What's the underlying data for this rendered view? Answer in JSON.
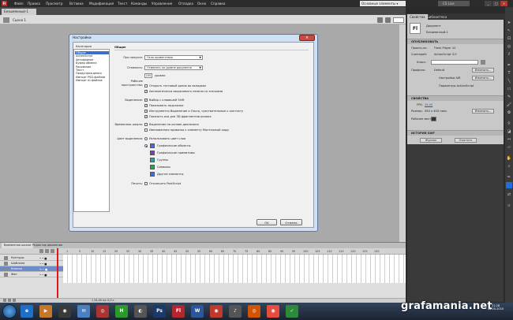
{
  "menubar": {
    "logo": "Fl",
    "items": [
      "Файл",
      "Правка",
      "Просмотр",
      "Вставка",
      "Модификация",
      "Текст",
      "Команды",
      "Управление",
      "Отладка",
      "Окно",
      "Справка"
    ],
    "workspace": "Основные элементы ▾",
    "search_icon": "search-icon",
    "cs_live": "CS Live"
  },
  "doc": {
    "tab": "Безымянный-1",
    "scene": "Сцена 1"
  },
  "dialog": {
    "title": "Настройки",
    "close": "×",
    "category_label": "Категория",
    "categories": [
      "Общие",
      "ActionScript",
      "Автоформат",
      "Буфер обмена",
      "Рисование",
      "Текст",
      "Предупреждения",
      "Импорт PSD-файлов",
      "Импорт AI-файлов"
    ],
    "section": "Общие",
    "on_launch_label": "При запуске:",
    "on_launch_value": "Окно приветствия",
    "undo_label": "Отменить:",
    "undo_value": "Отменить на уровне документа",
    "levels_value": "100",
    "levels_label": "уровни",
    "workspace_label": "Рабочее пространство:",
    "ws_opt1": "Открыть тестовый ролик во вкладках",
    "ws_opt2": "Автоматически сворачивать панели со значками",
    "selection_label": "Выделение:",
    "sel_opt1": "Выбор с клавишей Shift",
    "sel_opt2": "Показывать подсказки",
    "sel_opt3": "Инструменты Выделение и Лассо, чувствительные к контакту",
    "sel_opt4": "Показать оси для 3D-фрагментов ролика",
    "timeline_label": "Временная шкала:",
    "tl_opt1": "Выделение на основе диапазона",
    "tl_opt2": "Именованная привязка к элементу Монтажный кадр",
    "highlight_label": "Цвет выделения:",
    "hl_opt1": "Использовать цвет слоя",
    "hl_items": [
      "Графические объекты",
      "Графические примитивы",
      "Группы",
      "Символы",
      "Другие элементы"
    ],
    "hl_colors": [
      "#3f6fd1",
      "#7b3fa6",
      "#2aa3a0",
      "#2aa34c",
      "#3f6fd1"
    ],
    "printing_label": "Печать:",
    "print_opt": "Отключить PostScript",
    "ok": "OK",
    "cancel": "Отмена"
  },
  "right": {
    "tab_props": "Свойства",
    "tab_lib": "Библиотека",
    "doc_icon": "Fl",
    "doc_label": "Документ",
    "doc_name": "Безымянный-1",
    "publish_section": "ОПУБЛИКОВАТЬ",
    "player_label": "Проигр-ль:",
    "player_value": "Flash Player 10",
    "script_label": "Сценарий:",
    "script_value": "ActionScript 3.0",
    "class_label": "Класс:",
    "profile_label": "Профиль:",
    "profile_value": "Default",
    "edit_btn": "Изменить...",
    "air_label": "Настройки AIR",
    "as_label": "Параметры ActionScript",
    "props_section": "СВОЙСТВА",
    "fps_label": "FPS:",
    "fps_value": "24,00",
    "size_label": "Размер:",
    "size_value": "550 x 400 пикс.",
    "stage_label": "Рабочее место:",
    "history_section": "ИСТОРИЯ SWF",
    "journal_btn": "Журнал",
    "clear_btn": "Очистить"
  },
  "timeline": {
    "tab1": "Временная шкала",
    "tab2": "Редактор движения",
    "frames": [
      1,
      5,
      10,
      15,
      20,
      25,
      30,
      35,
      40,
      45,
      50,
      55,
      60,
      65,
      70,
      75,
      80,
      85,
      90,
      95,
      100,
      105,
      110,
      115,
      120,
      125,
      130
    ],
    "layers": [
      "Контуры",
      "Шаблона",
      "Кнопки",
      "Фон"
    ],
    "selected_layer": 2,
    "status": "1   24,00 к/с   0,0 с"
  },
  "taskbar": {
    "apps": [
      {
        "label": "e",
        "color": "#1e6fc7"
      },
      {
        "label": "▶",
        "color": "#c7772a"
      },
      {
        "label": "◉",
        "color": "#3a3a3a"
      },
      {
        "label": "✉",
        "color": "#4a7fc1"
      },
      {
        "label": "◎",
        "color": "#a33"
      },
      {
        "label": "H",
        "color": "#2a9a2a"
      },
      {
        "label": "◐",
        "color": "#555"
      },
      {
        "label": "Ps",
        "color": "#1b3a6b"
      },
      {
        "label": "Fl",
        "color": "#b3262d"
      },
      {
        "label": "W",
        "color": "#2b579a"
      },
      {
        "label": "◉",
        "color": "#c0392b"
      },
      {
        "label": "♪",
        "color": "#555"
      },
      {
        "label": "◎",
        "color": "#d35400"
      },
      {
        "label": "◉",
        "color": "#e74c3c"
      },
      {
        "label": "✓",
        "color": "#2c8a3a"
      }
    ],
    "watermark": "grafamania.net",
    "clock": "21:28",
    "date": "06.05.2010"
  }
}
